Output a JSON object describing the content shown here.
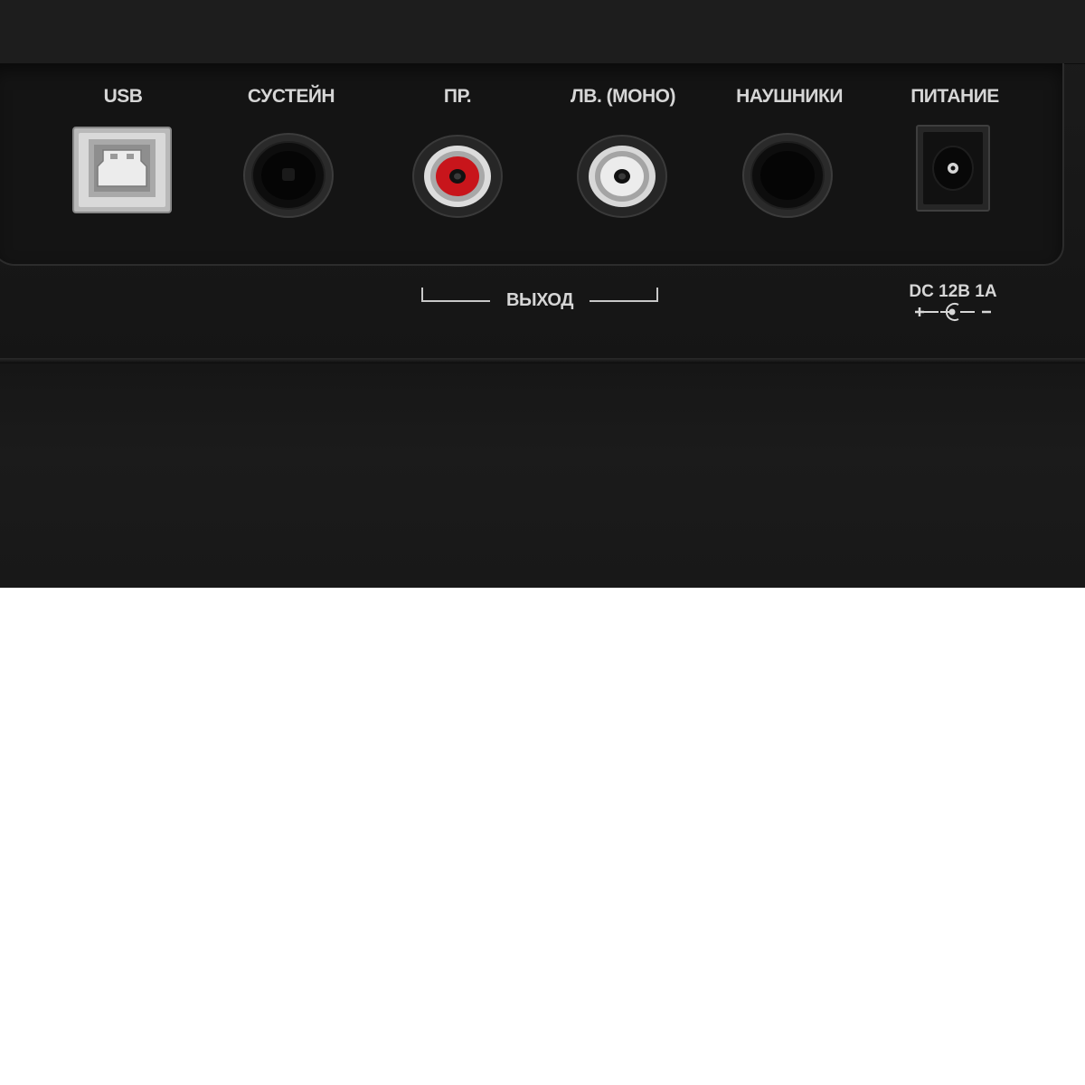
{
  "ports": [
    {
      "label": "USB",
      "icon": "usb-b-port-icon"
    },
    {
      "label": "СУСТЕЙН",
      "icon": "jack-socket-icon"
    },
    {
      "label": "ПР.",
      "icon": "rca-socket-red-icon"
    },
    {
      "label": "ЛВ. (МОНО)",
      "icon": "rca-socket-white-icon"
    },
    {
      "label": "НАУШНИКИ",
      "icon": "jack-socket-icon"
    },
    {
      "label": "ПИТАНИЕ",
      "icon": "dc-power-socket-icon"
    }
  ],
  "output_group": {
    "label": "ВЫХОД"
  },
  "power_spec": {
    "label": "DC 12В 1А",
    "polarity_icon": "center-positive-polarity-icon"
  },
  "colors": {
    "panel": "#1a1a1a",
    "label_text": "#d6d6d6",
    "rca_right": "#c8151b",
    "rca_left": "#e8e8e8"
  }
}
